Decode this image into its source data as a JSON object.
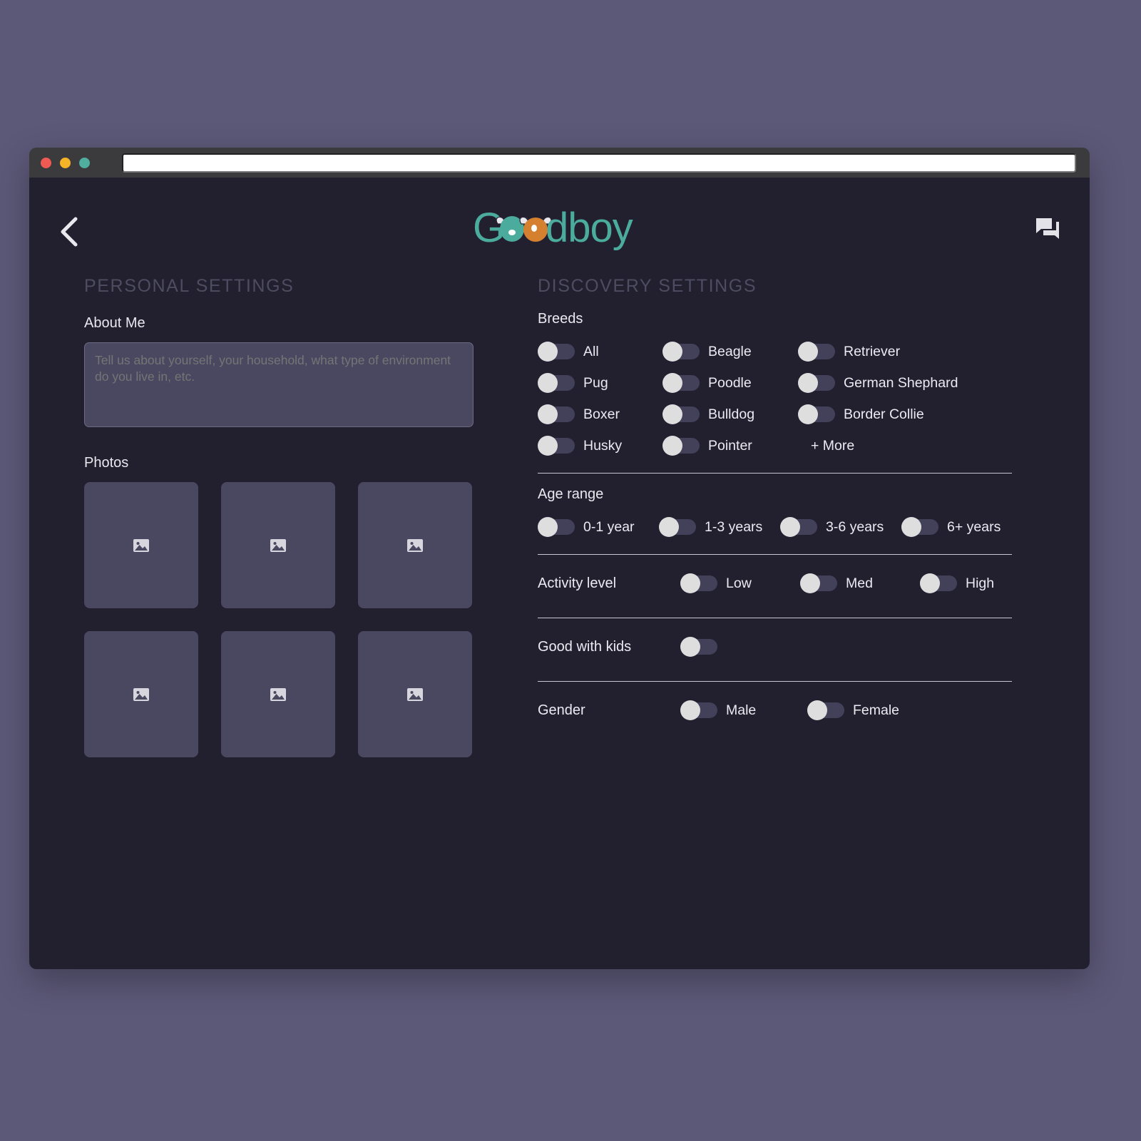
{
  "browser": {
    "traffic_lights": [
      "close",
      "minimize",
      "maximize"
    ],
    "url_value": "",
    "url_placeholder": ""
  },
  "app": {
    "brand": "Goodboy",
    "back_icon": "chevron-left-icon",
    "chat_icon": "forum-chat-icon"
  },
  "personal": {
    "section_title": "PERSONAL SETTINGS",
    "about_label": "About Me",
    "about_placeholder": "Tell us about yourself, your household, what type of environment do you live in, etc.",
    "about_value": "",
    "photos_label": "Photos",
    "photo_tiles": [
      {
        "icon": "image-placeholder-icon"
      },
      {
        "icon": "image-placeholder-icon"
      },
      {
        "icon": "image-placeholder-icon"
      },
      {
        "icon": "image-placeholder-icon"
      },
      {
        "icon": "image-placeholder-icon"
      },
      {
        "icon": "image-placeholder-icon"
      }
    ]
  },
  "discovery": {
    "section_title": "DISCOVERY SETTINGS",
    "breeds": {
      "label": "Breeds",
      "items": [
        {
          "label": "All",
          "on": false
        },
        {
          "label": "Beagle",
          "on": false
        },
        {
          "label": "Retriever",
          "on": false
        },
        {
          "label": "Pug",
          "on": false
        },
        {
          "label": "Poodle",
          "on": false
        },
        {
          "label": "German Shephard",
          "on": false
        },
        {
          "label": "Boxer",
          "on": false
        },
        {
          "label": "Bulldog",
          "on": false
        },
        {
          "label": "Border Collie",
          "on": false
        },
        {
          "label": "Husky",
          "on": false
        },
        {
          "label": "Pointer",
          "on": false
        }
      ],
      "more_label": "+ More"
    },
    "age_range": {
      "label": "Age range",
      "items": [
        {
          "label": "0-1 year",
          "on": false
        },
        {
          "label": "1-3 years",
          "on": false
        },
        {
          "label": "3-6 years",
          "on": false
        },
        {
          "label": "6+ years",
          "on": false
        }
      ]
    },
    "activity": {
      "label": "Activity level",
      "items": [
        {
          "label": "Low",
          "on": false
        },
        {
          "label": "Med",
          "on": false
        },
        {
          "label": "High",
          "on": false
        }
      ]
    },
    "good_with_kids": {
      "label": "Good with kids",
      "items": [
        {
          "label": "",
          "on": false
        }
      ]
    },
    "gender": {
      "label": "Gender",
      "items": [
        {
          "label": "Male",
          "on": false
        },
        {
          "label": "Female",
          "on": false
        }
      ]
    }
  },
  "colors": {
    "page_background": "#5c5878",
    "titlebar": "#3b3b3d",
    "app_background": "#22202f",
    "surface": "#4a4760",
    "toggle_track": "#43415a",
    "toggle_knob": "#dededf",
    "brand_teal": "#4bab9c",
    "brand_orange": "#d4802f",
    "heading_dim": "#4e4c60",
    "text": "#eceaf1",
    "divider": "#c8c6d4",
    "dot_red": "#ef5b52",
    "dot_yellow": "#f5b427",
    "dot_green": "#4fae9e"
  }
}
